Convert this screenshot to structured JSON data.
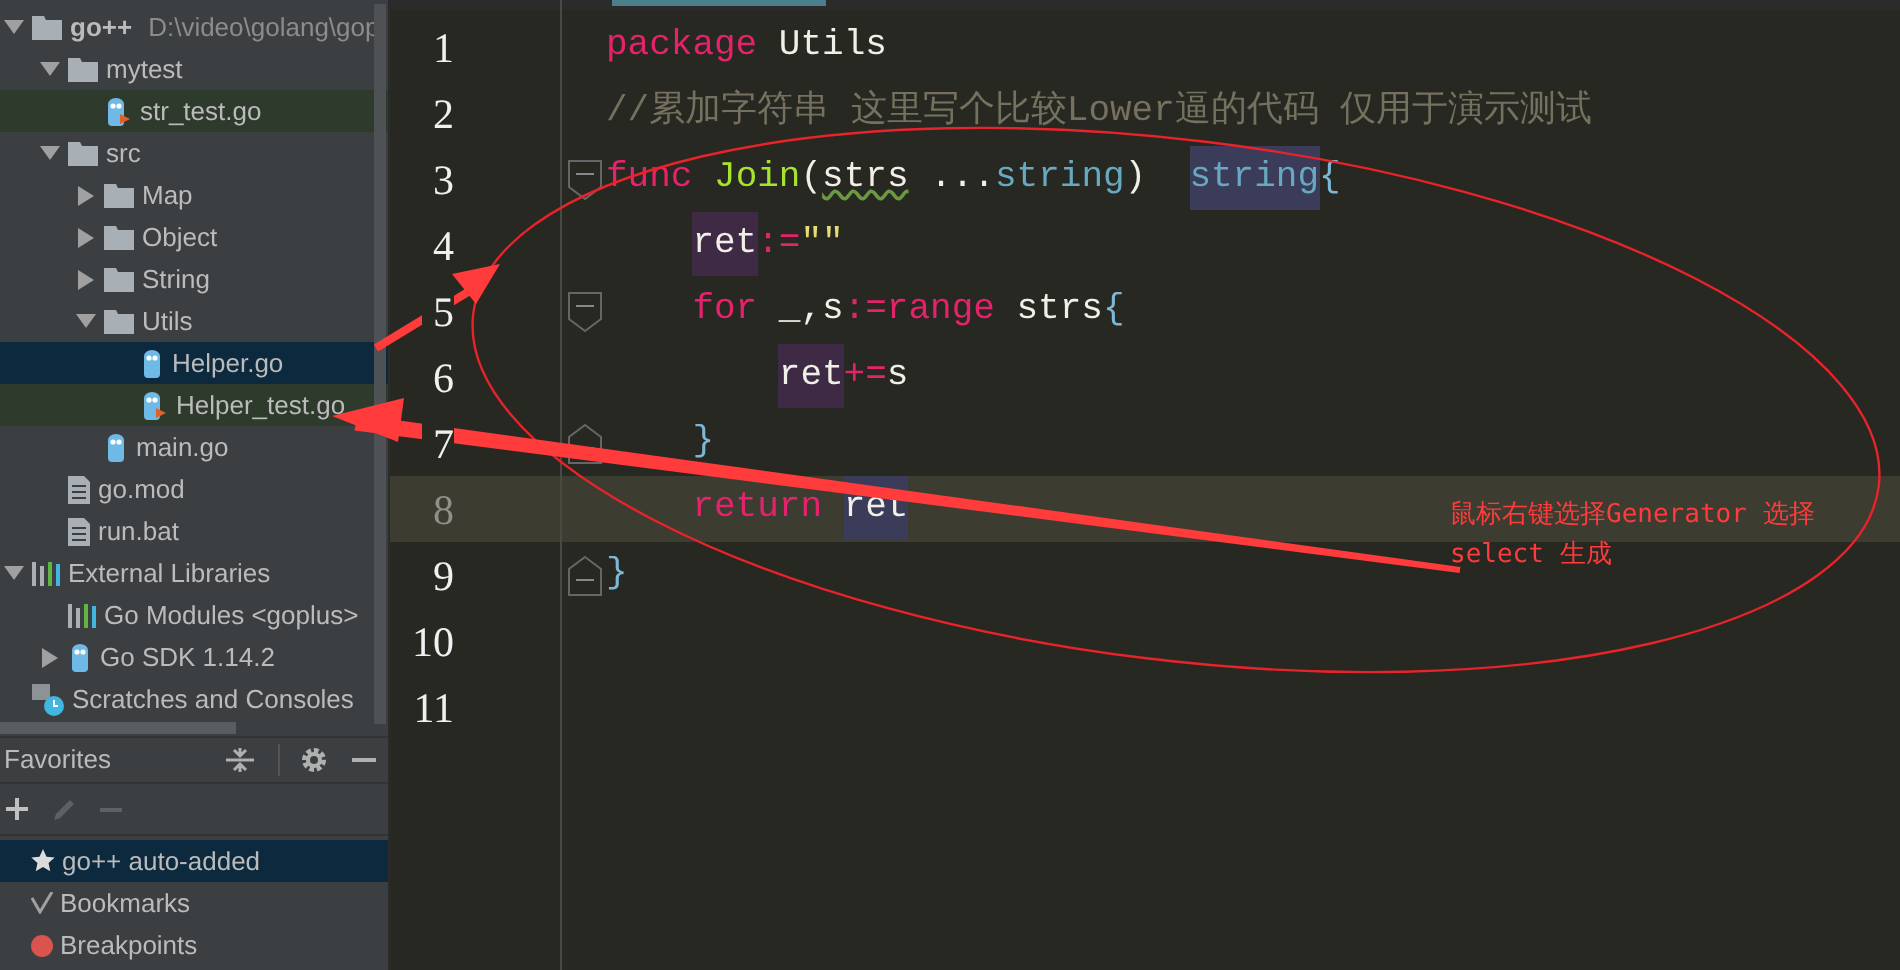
{
  "project_tree": [
    {
      "label": "go++",
      "path": "D:\\video\\golang\\gop",
      "kind": "root",
      "expanded": true,
      "selected": false,
      "children": [
        {
          "label": "mytest",
          "kind": "folder",
          "expanded": true,
          "selected": false,
          "children": [
            {
              "label": "str_test.go",
              "kind": "go_test",
              "selected": false
            }
          ]
        },
        {
          "label": "src",
          "kind": "folder",
          "expanded": true,
          "selected": false,
          "children": [
            {
              "label": "Map",
              "kind": "folder",
              "expanded": false,
              "selected": false
            },
            {
              "label": "Object",
              "kind": "folder",
              "expanded": false,
              "selected": false
            },
            {
              "label": "String",
              "kind": "folder",
              "expanded": false,
              "selected": false
            },
            {
              "label": "Utils",
              "kind": "folder",
              "expanded": true,
              "selected": false,
              "children": [
                {
                  "label": "Helper.go",
                  "kind": "go",
                  "selected": true
                },
                {
                  "label": "Helper_test.go",
                  "kind": "go_test",
                  "selected": false
                }
              ]
            },
            {
              "label": "main.go",
              "kind": "go",
              "selected": false
            }
          ]
        },
        {
          "label": "go.mod",
          "kind": "text",
          "selected": false
        },
        {
          "label": "run.bat",
          "kind": "text",
          "selected": false
        }
      ]
    },
    {
      "label": "External Libraries",
      "kind": "library",
      "expanded": true,
      "selected": false,
      "children": [
        {
          "label": "Go Modules <goplus>",
          "kind": "library",
          "selected": false
        },
        {
          "label": "Go SDK 1.14.2",
          "kind": "sdk",
          "expanded": false,
          "selected": false
        }
      ]
    },
    {
      "label": "Scratches and Consoles",
      "kind": "scratch",
      "selected": false
    }
  ],
  "favorites": {
    "title": "Favorites",
    "items": [
      {
        "label": "go++  auto-added",
        "kind": "star",
        "selected": true
      },
      {
        "label": "Bookmarks",
        "kind": "check",
        "selected": false
      },
      {
        "label": "Breakpoints",
        "kind": "dot",
        "selected": false
      }
    ]
  },
  "editor": {
    "lines": [
      {
        "number": "1",
        "current": false,
        "tokens": [
          {
            "text": "package",
            "kind": "keyword"
          },
          {
            "text": " Utils",
            "kind": "ident"
          }
        ]
      },
      {
        "number": "2",
        "current": false,
        "tokens": [
          {
            "text": "//累加字符串 这里写个比较Lower逼的代码 仅用于演示测试",
            "kind": "comment"
          }
        ]
      },
      {
        "number": "3",
        "current": false,
        "fold_start": true,
        "tokens": [
          {
            "text": "func ",
            "kind": "keyword"
          },
          {
            "text": "Join",
            "kind": "func"
          },
          {
            "text": "(",
            "kind": "ident"
          },
          {
            "text": "strs",
            "kind": "ident",
            "warning": true
          },
          {
            "text": " ...",
            "kind": "ident"
          },
          {
            "text": "string",
            "kind": "type"
          },
          {
            "text": ")  ",
            "kind": "ident"
          },
          {
            "text": "string",
            "kind": "type",
            "highlighted": true,
            "write_access": false
          },
          {
            "text": "{",
            "kind": "brace"
          }
        ],
        "children": [
          {
            "number": "4",
            "current": false,
            "tokens": [
              {
                "text": "ret",
                "kind": "ident",
                "highlighted": true,
                "write_access": true
              },
              {
                "text": ":=",
                "kind": "operator"
              },
              {
                "text": "\"\"",
                "kind": "string"
              }
            ]
          },
          {
            "number": "5",
            "current": false,
            "fold_start": true,
            "tokens": [
              {
                "text": "for",
                "kind": "keyword"
              },
              {
                "text": " _,s",
                "kind": "ident"
              },
              {
                "text": ":=range",
                "kind": "operator"
              },
              {
                "text": " strs",
                "kind": "ident"
              },
              {
                "text": "{",
                "kind": "brace"
              }
            ],
            "children": [
              {
                "number": "6",
                "current": false,
                "tokens": [
                  {
                    "text": "ret",
                    "kind": "ident",
                    "highlighted": true,
                    "write_access": true
                  },
                  {
                    "text": "+=",
                    "kind": "operator"
                  },
                  {
                    "text": "s",
                    "kind": "ident"
                  }
                ]
              }
            ]
          },
          {
            "number": "7",
            "current": false,
            "fold_end": true,
            "tokens": [
              {
                "text": "}",
                "kind": "brace"
              }
            ]
          },
          {
            "number": "8",
            "current": true,
            "tokens": [
              {
                "text": "return ",
                "kind": "keyword"
              },
              {
                "text": "ret",
                "kind": "ident",
                "highlighted": true,
                "write_access": false
              }
            ]
          }
        ]
      },
      {
        "number": "9",
        "current": false,
        "fold_end": true,
        "tokens": [
          {
            "text": "}",
            "kind": "brace"
          }
        ]
      },
      {
        "number": "10",
        "current": false
      },
      {
        "number": "11",
        "current": false
      }
    ]
  },
  "annotation": {
    "lines": [
      "鼠标右键选择Generator 选择",
      "select 生成"
    ]
  }
}
